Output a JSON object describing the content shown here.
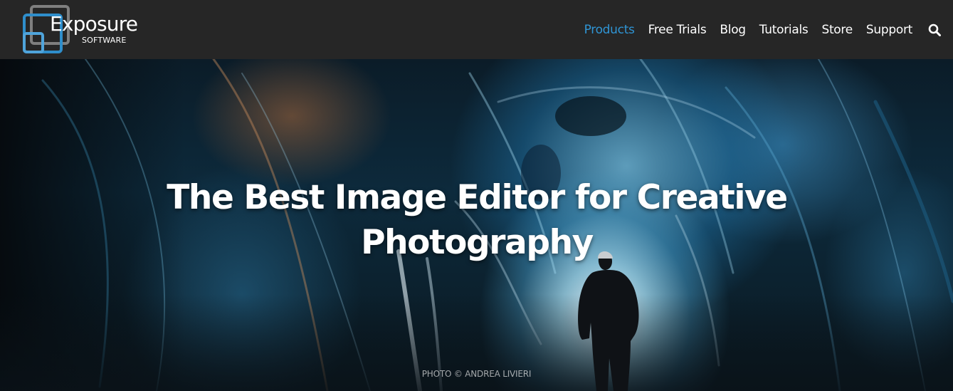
{
  "header": {
    "logo": {
      "word": "Exposure",
      "sub": "SOFTWARE"
    },
    "nav": [
      {
        "label": "Products",
        "active": true
      },
      {
        "label": "Free Trials",
        "active": false
      },
      {
        "label": "Blog",
        "active": false
      },
      {
        "label": "Tutorials",
        "active": false
      },
      {
        "label": "Store",
        "active": false
      },
      {
        "label": "Support",
        "active": false
      }
    ],
    "search_icon": "search-icon"
  },
  "hero": {
    "title_line1": "The Best Image Editor for Creative",
    "title_line2": "Photography",
    "credit": "PHOTO © ANDREA LIVIERI"
  },
  "colors": {
    "header_bg": "#262626",
    "accent": "#2f95d5",
    "text": "#ffffff"
  }
}
